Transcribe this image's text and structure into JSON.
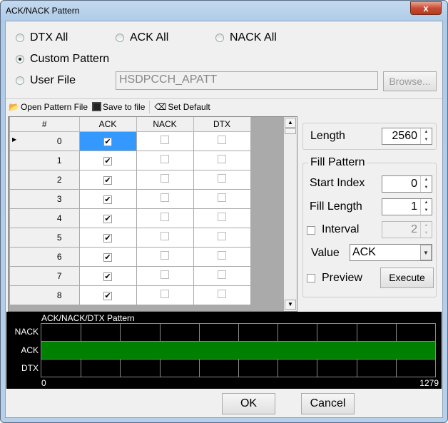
{
  "window": {
    "title": "ACK/NACK Pattern",
    "close_label": "x"
  },
  "mode": {
    "options": [
      {
        "label": "DTX All",
        "selected": false
      },
      {
        "label": "ACK All",
        "selected": false
      },
      {
        "label": "NACK All",
        "selected": false
      },
      {
        "label": "Custom Pattern",
        "selected": true
      },
      {
        "label": "User File",
        "selected": false
      }
    ]
  },
  "user_file": {
    "value": "HSDPCCH_APATT",
    "browse_label": "Browse..."
  },
  "toolbar": {
    "open_label": "Open Pattern File",
    "save_label": "Save to file",
    "default_label": "Set Default"
  },
  "table": {
    "columns": [
      "#",
      "ACK",
      "NACK",
      "DTX"
    ],
    "rows": [
      {
        "index": "0",
        "ack": true,
        "nack": false,
        "dtx": false
      },
      {
        "index": "1",
        "ack": true,
        "nack": false,
        "dtx": false
      },
      {
        "index": "2",
        "ack": true,
        "nack": false,
        "dtx": false
      },
      {
        "index": "3",
        "ack": true,
        "nack": false,
        "dtx": false
      },
      {
        "index": "4",
        "ack": true,
        "nack": false,
        "dtx": false
      },
      {
        "index": "5",
        "ack": true,
        "nack": false,
        "dtx": false
      },
      {
        "index": "6",
        "ack": true,
        "nack": false,
        "dtx": false
      },
      {
        "index": "7",
        "ack": true,
        "nack": false,
        "dtx": false
      },
      {
        "index": "8",
        "ack": true,
        "nack": false,
        "dtx": false
      }
    ]
  },
  "length": {
    "label": "Length",
    "value": "2560"
  },
  "fill": {
    "title": "Fill Pattern",
    "start_label": "Start Index",
    "start_value": "0",
    "fill_length_label": "Fill Length",
    "fill_length_value": "1",
    "interval_label": "Interval",
    "interval_value": "2",
    "interval_checked": false,
    "value_label": "Value",
    "value_selected": "ACK",
    "preview_label": "Preview",
    "preview_checked": false,
    "execute_label": "Execute"
  },
  "chart": {
    "title": "ACK/NACK/DTX Pattern",
    "rows": [
      "NACK",
      "ACK",
      "DTX"
    ],
    "x_start": "0",
    "x_end": "1279",
    "active_row": "ACK",
    "active_color": "#008000"
  },
  "footer": {
    "ok_label": "OK",
    "cancel_label": "Cancel"
  }
}
